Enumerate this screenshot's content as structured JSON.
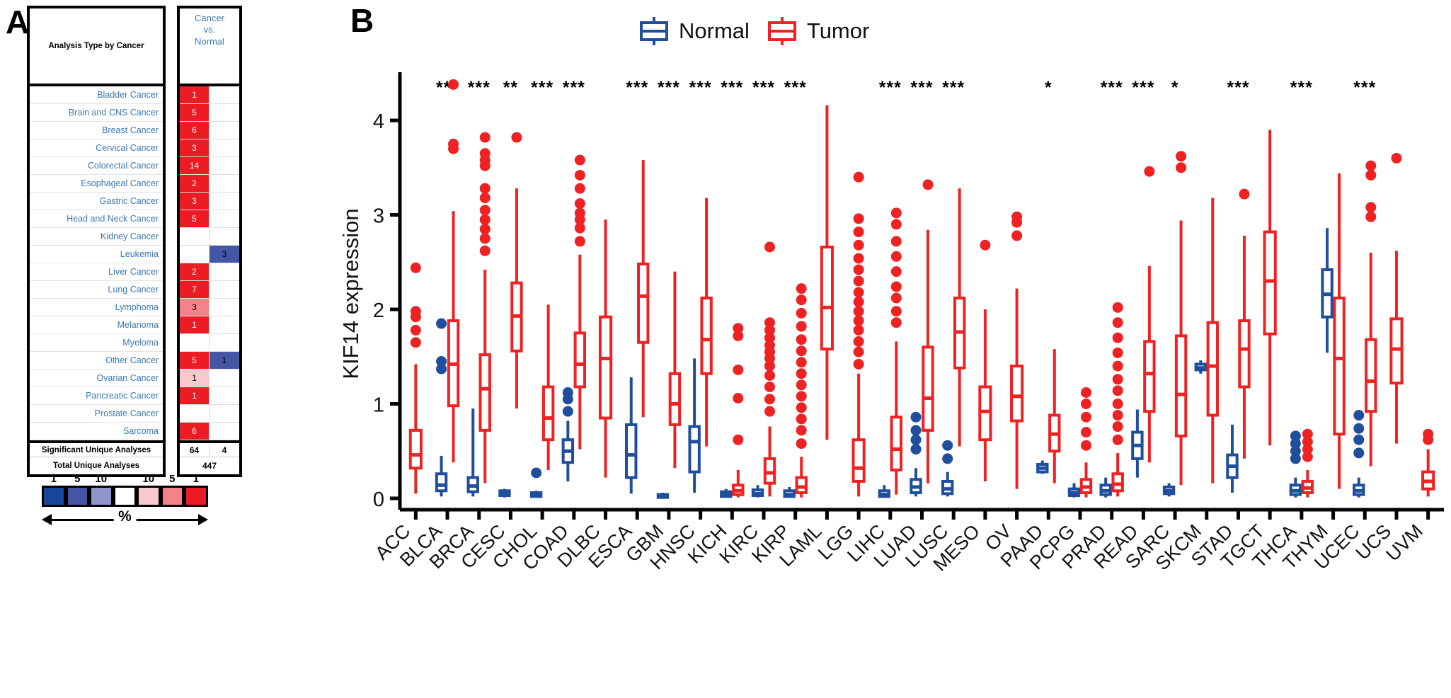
{
  "panels": {
    "a_letter": "A",
    "b_letter": "B"
  },
  "oncomine": {
    "header_left": "Analysis Type by Cancer",
    "header_right": "Cancer\nvs.\nNormal",
    "header_right_lines": [
      "Cancer",
      "vs.",
      "Normal"
    ],
    "rows": [
      {
        "label": "Bladder Cancer",
        "over": "1",
        "under": ""
      },
      {
        "label": "Brain and CNS Cancer",
        "over": "5",
        "under": ""
      },
      {
        "label": "Breast Cancer",
        "over": "6",
        "under": ""
      },
      {
        "label": "Cervical Cancer",
        "over": "3",
        "under": ""
      },
      {
        "label": "Colorectal Cancer",
        "over": "14",
        "under": ""
      },
      {
        "label": "Esophageal Cancer",
        "over": "2",
        "under": ""
      },
      {
        "label": "Gastric Cancer",
        "over": "3",
        "under": ""
      },
      {
        "label": "Head and Neck Cancer",
        "over": "5",
        "under": ""
      },
      {
        "label": "Kidney Cancer",
        "over": "",
        "under": ""
      },
      {
        "label": "Leukemia",
        "over": "",
        "under": "3"
      },
      {
        "label": "Liver Cancer",
        "over": "2",
        "under": ""
      },
      {
        "label": "Lung Cancer",
        "over": "7",
        "under": ""
      },
      {
        "label": "Lymphoma",
        "over": "3",
        "under": ""
      },
      {
        "label": "Melanoma",
        "over": "1",
        "under": ""
      },
      {
        "label": "Myeloma",
        "over": "",
        "under": ""
      },
      {
        "label": "Other Cancer",
        "over": "5",
        "under": "1"
      },
      {
        "label": "Ovarian Cancer",
        "over": "1",
        "under": ""
      },
      {
        "label": "Pancreatic Cancer",
        "over": "1",
        "under": ""
      },
      {
        "label": "Prostate Cancer",
        "over": "",
        "under": ""
      },
      {
        "label": "Sarcoma",
        "over": "6",
        "under": ""
      }
    ],
    "row_styles": [
      {
        "over": "v-red",
        "under": "empty"
      },
      {
        "over": "v-red",
        "under": "empty"
      },
      {
        "over": "v-red",
        "under": "empty"
      },
      {
        "over": "v-red",
        "under": "empty"
      },
      {
        "over": "v-red",
        "under": "empty"
      },
      {
        "over": "v-red",
        "under": "empty"
      },
      {
        "over": "v-red",
        "under": "empty"
      },
      {
        "over": "v-red",
        "under": "empty"
      },
      {
        "over": "empty",
        "under": "empty"
      },
      {
        "over": "empty",
        "under": "v-blue"
      },
      {
        "over": "v-red",
        "under": "empty"
      },
      {
        "over": "v-red",
        "under": "empty"
      },
      {
        "over": "v-red2",
        "under": "empty"
      },
      {
        "over": "v-red",
        "under": "empty"
      },
      {
        "over": "empty",
        "under": "empty"
      },
      {
        "over": "v-red",
        "under": "v-blue"
      },
      {
        "over": "v-red3",
        "under": "empty"
      },
      {
        "over": "v-red",
        "under": "empty"
      },
      {
        "over": "empty",
        "under": "empty"
      },
      {
        "over": "v-red",
        "under": "empty"
      }
    ],
    "significant_label": "Significant Unique Analyses",
    "significant_over": "64",
    "significant_under": "4",
    "total_label": "Total Unique Analyses",
    "total_value": "447",
    "legend": {
      "numbers": [
        "1",
        "5",
        "10",
        "",
        "10",
        "5",
        "1"
      ],
      "colors": [
        "#16479d",
        "#4557a4",
        "#8d97cc",
        "#ffffff",
        "#f9c9ce",
        "#f4828a",
        "#ec1c24"
      ],
      "axis_label": "%"
    }
  },
  "boxplot": {
    "legend": [
      {
        "name": "Normal",
        "color": "#1f4e9c"
      },
      {
        "name": "Tumor",
        "color": "#ee2222"
      }
    ],
    "ylabel": "KIF14 expression",
    "yticks": [
      "0",
      "1",
      "2",
      "3",
      "4"
    ]
  },
  "chart_data": {
    "type": "box",
    "title": "",
    "xlabel": "",
    "ylabel": "KIF14 expression",
    "ylim": [
      -0.12,
      4.45
    ],
    "yticks": [
      0,
      1,
      2,
      3,
      4
    ],
    "grid": false,
    "legend_position": "top-right",
    "series": [
      {
        "name": "Normal",
        "color": "#1f4e9c"
      },
      {
        "name": "Tumor",
        "color": "#ee2222"
      }
    ],
    "categories": [
      "ACC",
      "BLCA",
      "BRCA",
      "CESC",
      "CHOL",
      "COAD",
      "DLBC",
      "ESCA",
      "GBM",
      "HNSC",
      "KICH",
      "KIRC",
      "KIRP",
      "LAML",
      "LGG",
      "LIHC",
      "LUAD",
      "LUSC",
      "MESO",
      "OV",
      "PAAD",
      "PCPG",
      "PRAD",
      "READ",
      "SARC",
      "SKCM",
      "STAD",
      "TGCT",
      "THCA",
      "THYM",
      "UCEC",
      "UCS",
      "UVM"
    ],
    "significance": [
      "",
      "***",
      "***",
      "**",
      "***",
      "***",
      "",
      "***",
      "***",
      "***",
      "***",
      "***",
      "***",
      "",
      "",
      "***",
      "***",
      "***",
      "",
      "",
      "*",
      "",
      "***",
      "***",
      "*",
      "",
      "***",
      "",
      "***",
      "",
      "***",
      "",
      ""
    ],
    "boxes": [
      {
        "cat": "ACC",
        "group": "Tumor",
        "q1": 0.32,
        "med": 0.46,
        "q3": 0.72,
        "lo": 0.05,
        "hi": 1.42,
        "outliers": [
          1.65,
          1.78,
          1.92,
          1.98,
          2.44
        ]
      },
      {
        "cat": "BLCA",
        "group": "Normal",
        "q1": 0.08,
        "med": 0.14,
        "q3": 0.26,
        "lo": 0.02,
        "hi": 0.45,
        "outliers": [
          1.37,
          1.45,
          1.85
        ]
      },
      {
        "cat": "BLCA",
        "group": "Tumor",
        "q1": 0.98,
        "med": 1.42,
        "q3": 1.88,
        "lo": 0.38,
        "hi": 3.04,
        "outliers": [
          3.7,
          3.75,
          4.38
        ]
      },
      {
        "cat": "BRCA",
        "group": "Normal",
        "q1": 0.07,
        "med": 0.13,
        "q3": 0.22,
        "lo": 0.02,
        "hi": 0.95,
        "outliers": []
      },
      {
        "cat": "BRCA",
        "group": "Tumor",
        "q1": 0.72,
        "med": 1.16,
        "q3": 1.52,
        "lo": 0.16,
        "hi": 2.42,
        "outliers": [
          2.62,
          2.75,
          2.85,
          2.95,
          3.05,
          3.18,
          3.28,
          3.52,
          3.58,
          3.65,
          3.82
        ]
      },
      {
        "cat": "CESC",
        "group": "Normal",
        "q1": 0.03,
        "med": 0.05,
        "q3": 0.08,
        "lo": 0.01,
        "hi": 0.1,
        "outliers": []
      },
      {
        "cat": "CESC",
        "group": "Tumor",
        "q1": 1.56,
        "med": 1.93,
        "q3": 2.28,
        "lo": 0.95,
        "hi": 3.28,
        "outliers": [
          3.82
        ]
      },
      {
        "cat": "CHOL",
        "group": "Normal",
        "q1": 0.02,
        "med": 0.04,
        "q3": 0.06,
        "lo": 0.01,
        "hi": 0.08,
        "outliers": [
          0.27
        ]
      },
      {
        "cat": "CHOL",
        "group": "Tumor",
        "q1": 0.62,
        "med": 0.85,
        "q3": 1.18,
        "lo": 0.3,
        "hi": 2.05,
        "outliers": []
      },
      {
        "cat": "COAD",
        "group": "Normal",
        "q1": 0.38,
        "med": 0.5,
        "q3": 0.62,
        "lo": 0.18,
        "hi": 0.82,
        "outliers": [
          0.92,
          1.05,
          1.12
        ]
      },
      {
        "cat": "COAD",
        "group": "Tumor",
        "q1": 1.18,
        "med": 1.42,
        "q3": 1.75,
        "lo": 0.52,
        "hi": 2.58,
        "outliers": [
          2.72,
          2.86,
          2.95,
          3.02,
          3.12,
          3.28,
          3.42,
          3.58
        ]
      },
      {
        "cat": "DLBC",
        "group": "Tumor",
        "q1": 0.85,
        "med": 1.48,
        "q3": 1.92,
        "lo": 0.22,
        "hi": 2.95,
        "outliers": []
      },
      {
        "cat": "ESCA",
        "group": "Normal",
        "q1": 0.22,
        "med": 0.46,
        "q3": 0.78,
        "lo": 0.05,
        "hi": 1.28,
        "outliers": []
      },
      {
        "cat": "ESCA",
        "group": "Tumor",
        "q1": 1.65,
        "med": 2.14,
        "q3": 2.48,
        "lo": 0.86,
        "hi": 3.58,
        "outliers": []
      },
      {
        "cat": "GBM",
        "group": "Normal",
        "q1": 0.01,
        "med": 0.02,
        "q3": 0.04,
        "lo": 0.01,
        "hi": 0.06,
        "outliers": []
      },
      {
        "cat": "GBM",
        "group": "Tumor",
        "q1": 0.78,
        "med": 1.0,
        "q3": 1.32,
        "lo": 0.32,
        "hi": 2.4,
        "outliers": []
      },
      {
        "cat": "HNSC",
        "group": "Normal",
        "q1": 0.28,
        "med": 0.6,
        "q3": 0.76,
        "lo": 0.06,
        "hi": 1.48,
        "outliers": []
      },
      {
        "cat": "HNSC",
        "group": "Tumor",
        "q1": 1.32,
        "med": 1.68,
        "q3": 2.12,
        "lo": 0.55,
        "hi": 3.18,
        "outliers": []
      },
      {
        "cat": "KICH",
        "group": "Normal",
        "q1": 0.02,
        "med": 0.04,
        "q3": 0.07,
        "lo": 0.01,
        "hi": 0.1,
        "outliers": []
      },
      {
        "cat": "KICH",
        "group": "Tumor",
        "q1": 0.04,
        "med": 0.08,
        "q3": 0.14,
        "lo": 0.01,
        "hi": 0.3,
        "outliers": [
          0.62,
          1.06,
          1.36,
          1.72,
          1.8
        ]
      },
      {
        "cat": "KIRC",
        "group": "Normal",
        "q1": 0.03,
        "med": 0.05,
        "q3": 0.09,
        "lo": 0.01,
        "hi": 0.14,
        "outliers": []
      },
      {
        "cat": "KIRC",
        "group": "Tumor",
        "q1": 0.16,
        "med": 0.27,
        "q3": 0.42,
        "lo": 0.02,
        "hi": 0.76,
        "outliers": [
          0.92,
          1.05,
          1.18,
          1.3,
          1.4,
          1.48,
          1.55,
          1.62,
          1.7,
          1.78,
          1.86,
          2.66
        ]
      },
      {
        "cat": "KIRP",
        "group": "Normal",
        "q1": 0.02,
        "med": 0.04,
        "q3": 0.08,
        "lo": 0.01,
        "hi": 0.12,
        "outliers": []
      },
      {
        "cat": "KIRP",
        "group": "Tumor",
        "q1": 0.06,
        "med": 0.12,
        "q3": 0.22,
        "lo": 0.01,
        "hi": 0.44,
        "outliers": [
          0.58,
          0.72,
          0.84,
          0.96,
          1.08,
          1.2,
          1.32,
          1.44,
          1.56,
          1.68,
          1.82,
          1.96,
          2.1,
          2.22
        ]
      },
      {
        "cat": "LAML",
        "group": "Tumor",
        "q1": 1.58,
        "med": 2.02,
        "q3": 2.66,
        "lo": 0.62,
        "hi": 4.16,
        "outliers": []
      },
      {
        "cat": "LGG",
        "group": "Tumor",
        "q1": 0.18,
        "med": 0.32,
        "q3": 0.62,
        "lo": 0.02,
        "hi": 1.32,
        "outliers": [
          1.42,
          1.55,
          1.66,
          1.78,
          1.88,
          1.98,
          2.08,
          2.18,
          2.3,
          2.42,
          2.54,
          2.68,
          2.82,
          2.96,
          3.4
        ]
      },
      {
        "cat": "LIHC",
        "group": "Normal",
        "q1": 0.02,
        "med": 0.04,
        "q3": 0.08,
        "lo": 0.01,
        "hi": 0.14,
        "outliers": []
      },
      {
        "cat": "LIHC",
        "group": "Tumor",
        "q1": 0.3,
        "med": 0.52,
        "q3": 0.86,
        "lo": 0.04,
        "hi": 1.66,
        "outliers": [
          1.86,
          1.98,
          2.12,
          2.24,
          2.4,
          2.56,
          2.72,
          2.9,
          3.02
        ]
      },
      {
        "cat": "LUAD",
        "group": "Normal",
        "q1": 0.06,
        "med": 0.12,
        "q3": 0.2,
        "lo": 0.02,
        "hi": 0.32,
        "outliers": [
          0.52,
          0.62,
          0.72,
          0.86
        ]
      },
      {
        "cat": "LUAD",
        "group": "Tumor",
        "q1": 0.72,
        "med": 1.06,
        "q3": 1.6,
        "lo": 0.16,
        "hi": 2.84,
        "outliers": [
          3.32
        ]
      },
      {
        "cat": "LUSC",
        "group": "Normal",
        "q1": 0.05,
        "med": 0.1,
        "q3": 0.18,
        "lo": 0.02,
        "hi": 0.28,
        "outliers": [
          0.42,
          0.56
        ]
      },
      {
        "cat": "LUSC",
        "group": "Tumor",
        "q1": 1.38,
        "med": 1.76,
        "q3": 2.12,
        "lo": 0.55,
        "hi": 3.28,
        "outliers": []
      },
      {
        "cat": "MESO",
        "group": "Tumor",
        "q1": 0.62,
        "med": 0.92,
        "q3": 1.18,
        "lo": 0.18,
        "hi": 2.0,
        "outliers": [
          2.68
        ]
      },
      {
        "cat": "OV",
        "group": "Tumor",
        "q1": 0.82,
        "med": 1.08,
        "q3": 1.4,
        "lo": 0.1,
        "hi": 2.22,
        "outliers": [
          2.78,
          2.92,
          2.98
        ]
      },
      {
        "cat": "PAAD",
        "group": "Normal",
        "q1": 0.28,
        "med": 0.32,
        "q3": 0.36,
        "lo": 0.26,
        "hi": 0.4,
        "outliers": []
      },
      {
        "cat": "PAAD",
        "group": "Tumor",
        "q1": 0.5,
        "med": 0.68,
        "q3": 0.88,
        "lo": 0.16,
        "hi": 1.58,
        "outliers": []
      },
      {
        "cat": "PCPG",
        "group": "Normal",
        "q1": 0.03,
        "med": 0.06,
        "q3": 0.1,
        "lo": 0.01,
        "hi": 0.16,
        "outliers": []
      },
      {
        "cat": "PCPG",
        "group": "Tumor",
        "q1": 0.06,
        "med": 0.12,
        "q3": 0.2,
        "lo": 0.01,
        "hi": 0.38,
        "outliers": [
          0.56,
          0.7,
          0.86,
          1.0,
          1.12
        ]
      },
      {
        "cat": "PRAD",
        "group": "Normal",
        "q1": 0.04,
        "med": 0.08,
        "q3": 0.14,
        "lo": 0.01,
        "hi": 0.22,
        "outliers": []
      },
      {
        "cat": "PRAD",
        "group": "Tumor",
        "q1": 0.08,
        "med": 0.15,
        "q3": 0.26,
        "lo": 0.02,
        "hi": 0.48,
        "outliers": [
          0.62,
          0.76,
          0.88,
          1.0,
          1.14,
          1.26,
          1.4,
          1.54,
          1.7,
          1.86,
          2.02
        ]
      },
      {
        "cat": "READ",
        "group": "Normal",
        "q1": 0.42,
        "med": 0.56,
        "q3": 0.7,
        "lo": 0.22,
        "hi": 0.94,
        "outliers": []
      },
      {
        "cat": "READ",
        "group": "Tumor",
        "q1": 0.92,
        "med": 1.32,
        "q3": 1.66,
        "lo": 0.38,
        "hi": 2.46,
        "outliers": [
          3.46
        ]
      },
      {
        "cat": "SARC",
        "group": "Normal",
        "q1": 0.05,
        "med": 0.08,
        "q3": 0.12,
        "lo": 0.02,
        "hi": 0.16,
        "outliers": []
      },
      {
        "cat": "SARC",
        "group": "Tumor",
        "q1": 0.66,
        "med": 1.1,
        "q3": 1.72,
        "lo": 0.14,
        "hi": 2.94,
        "outliers": [
          3.5,
          3.62
        ]
      },
      {
        "cat": "SKCM",
        "group": "Normal",
        "q1": 1.36,
        "med": 1.38,
        "q3": 1.42,
        "lo": 1.32,
        "hi": 1.46,
        "outliers": []
      },
      {
        "cat": "SKCM",
        "group": "Tumor",
        "q1": 0.88,
        "med": 1.4,
        "q3": 1.86,
        "lo": 0.16,
        "hi": 3.18,
        "outliers": []
      },
      {
        "cat": "STAD",
        "group": "Normal",
        "q1": 0.22,
        "med": 0.34,
        "q3": 0.46,
        "lo": 0.06,
        "hi": 0.78,
        "outliers": []
      },
      {
        "cat": "STAD",
        "group": "Tumor",
        "q1": 1.18,
        "med": 1.58,
        "q3": 1.88,
        "lo": 0.42,
        "hi": 2.78,
        "outliers": [
          3.22
        ]
      },
      {
        "cat": "TGCT",
        "group": "Tumor",
        "q1": 1.74,
        "med": 2.3,
        "q3": 2.82,
        "lo": 0.56,
        "hi": 3.9,
        "outliers": []
      },
      {
        "cat": "THCA",
        "group": "Normal",
        "q1": 0.04,
        "med": 0.08,
        "q3": 0.14,
        "lo": 0.01,
        "hi": 0.22,
        "outliers": [
          0.42,
          0.5,
          0.58,
          0.66
        ]
      },
      {
        "cat": "THCA",
        "group": "Tumor",
        "q1": 0.06,
        "med": 0.11,
        "q3": 0.18,
        "lo": 0.01,
        "hi": 0.3,
        "outliers": [
          0.44,
          0.52,
          0.6,
          0.68
        ]
      },
      {
        "cat": "THYM",
        "group": "Normal",
        "q1": 1.92,
        "med": 2.16,
        "q3": 2.42,
        "lo": 1.54,
        "hi": 2.86,
        "outliers": []
      },
      {
        "cat": "THYM",
        "group": "Tumor",
        "q1": 0.68,
        "med": 1.48,
        "q3": 2.12,
        "lo": 0.1,
        "hi": 3.44,
        "outliers": []
      },
      {
        "cat": "UCEC",
        "group": "Normal",
        "q1": 0.04,
        "med": 0.08,
        "q3": 0.14,
        "lo": 0.01,
        "hi": 0.22,
        "outliers": [
          0.48,
          0.62,
          0.74,
          0.88
        ]
      },
      {
        "cat": "UCEC",
        "group": "Tumor",
        "q1": 0.92,
        "med": 1.24,
        "q3": 1.68,
        "lo": 0.34,
        "hi": 2.6,
        "outliers": [
          2.98,
          3.08,
          3.42,
          3.52
        ]
      },
      {
        "cat": "UCS",
        "group": "Tumor",
        "q1": 1.22,
        "med": 1.58,
        "q3": 1.9,
        "lo": 0.58,
        "hi": 2.62,
        "outliers": [
          3.6
        ]
      },
      {
        "cat": "UVM",
        "group": "Tumor",
        "q1": 0.1,
        "med": 0.18,
        "q3": 0.28,
        "lo": 0.02,
        "hi": 0.52,
        "outliers": [
          0.62,
          0.68
        ]
      }
    ]
  }
}
